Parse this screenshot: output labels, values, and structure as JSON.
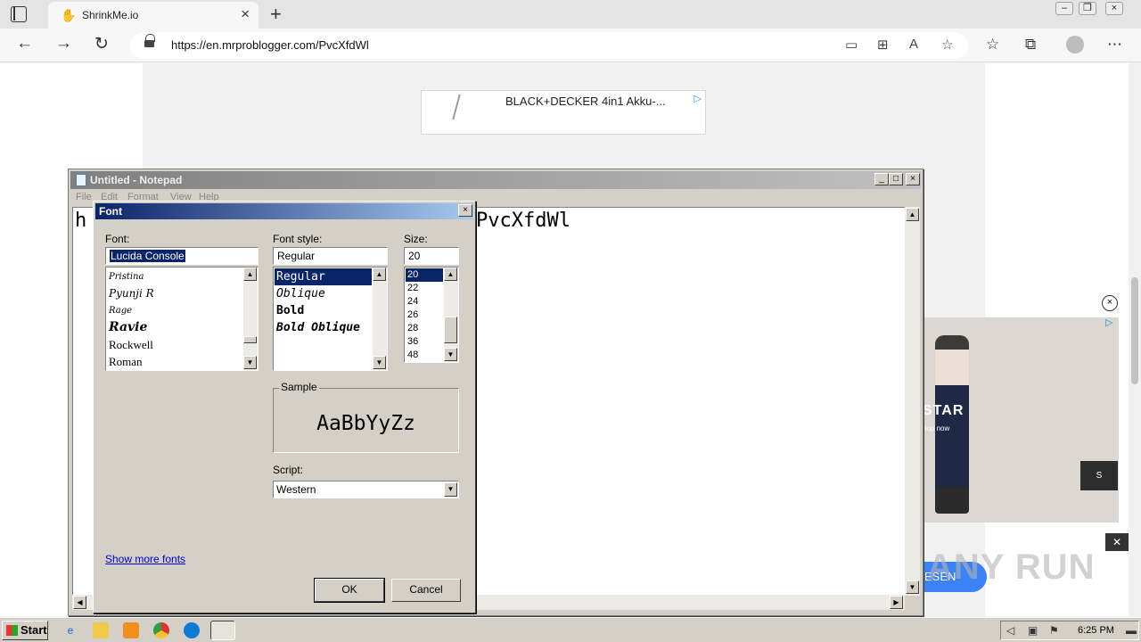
{
  "browser": {
    "tab_title": "ShrinkMe.io",
    "url": "https://en.mrproblogger.com/PvcXfdWl"
  },
  "ads": {
    "top_text": "BLACK+DECKER 4in1 Akku-...",
    "right_brand": "STAR",
    "right_shop": "hop now",
    "right_button": "S",
    "bottom_button": "ESEN",
    "watermark": "ANY RUN"
  },
  "notepad": {
    "title": "Untitled - Notepad",
    "menus": [
      "File",
      "Edit",
      "Format",
      "View",
      "Help"
    ],
    "text_visible_left": "h",
    "text_visible_right": "PvcXfdWl"
  },
  "font_dialog": {
    "title": "Font",
    "font_label": "Font:",
    "font_value": "Lucida Console",
    "font_list": [
      "Pristina",
      "Pyunji R",
      "Rage",
      "Ravie",
      "Rockwell",
      "Roman"
    ],
    "style_label": "Font style:",
    "style_value": "Regular",
    "style_list": [
      "Regular",
      "Oblique",
      "Bold",
      "Bold Oblique"
    ],
    "style_selected": "Regular",
    "size_label": "Size:",
    "size_value": "20",
    "size_list": [
      "20",
      "22",
      "24",
      "26",
      "28",
      "36",
      "48"
    ],
    "size_selected": "20",
    "sample_label": "Sample",
    "sample_text": "AaBbYyZz",
    "script_label": "Script:",
    "script_value": "Western",
    "show_more_fonts": "Show more fonts",
    "ok_label": "OK",
    "cancel_label": "Cancel"
  },
  "taskbar": {
    "start_label": "Start",
    "clock": "6:25 PM"
  }
}
